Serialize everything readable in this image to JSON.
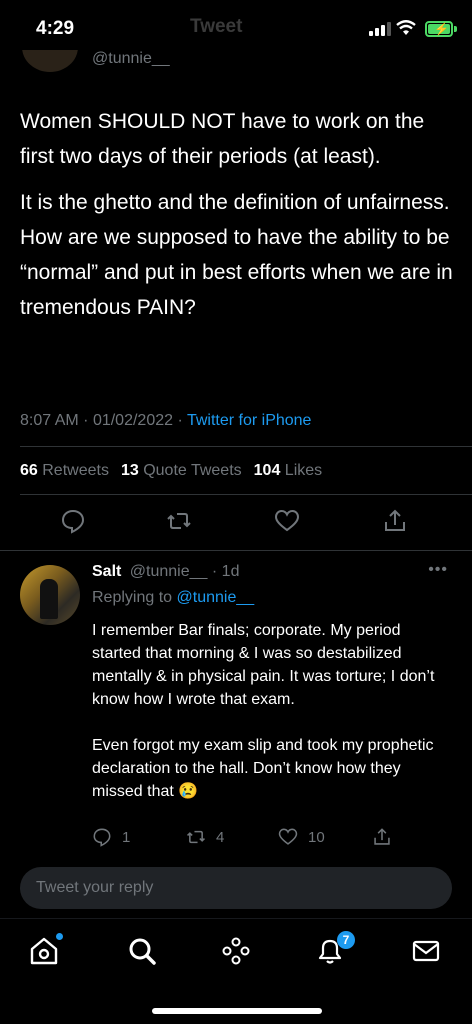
{
  "status_bar": {
    "time": "4:29",
    "ghost_title": "Tweet"
  },
  "author": {
    "handle": "@tunnie__"
  },
  "tweet": {
    "paragraphs": [
      "Women SHOULD NOT have to work on the first two days of their periods (at least).",
      "It is the ghetto and the definition of unfairness. How are we supposed to have the ability to be “normal” and put in best efforts when we are in tremendous PAIN?"
    ],
    "time": "8:07 AM",
    "date": "01/02/2022",
    "source": "Twitter for iPhone",
    "separator": "·"
  },
  "stats": {
    "retweets_count": "66",
    "retweets_label": "Retweets",
    "quotes_count": "13",
    "quotes_label": "Quote Tweets",
    "likes_count": "104",
    "likes_label": "Likes"
  },
  "reply": {
    "name": "Salt",
    "handle": "@tunnie__",
    "age": "· 1d",
    "more": "•••",
    "replying_label": "Replying to",
    "replying_to": "@tunnie__",
    "paragraphs": [
      "I remember Bar finals; corporate. My period started that morning &  I was so destabilized mentally & in physical pain. It was torture; I don’t know how I wrote that exam.",
      "Even forgot my exam slip and took my prophetic declaration to the hall. Don’t know how they missed that 😢"
    ],
    "reply_count": "1",
    "retweet_count": "4",
    "like_count": "10"
  },
  "compose": {
    "placeholder": "Tweet your reply"
  },
  "tab_bar": {
    "notifications_badge": "7"
  },
  "colors": {
    "accent": "#1d9bf0",
    "background": "#000000",
    "muted": "#71767b",
    "battery": "#4cd964"
  }
}
